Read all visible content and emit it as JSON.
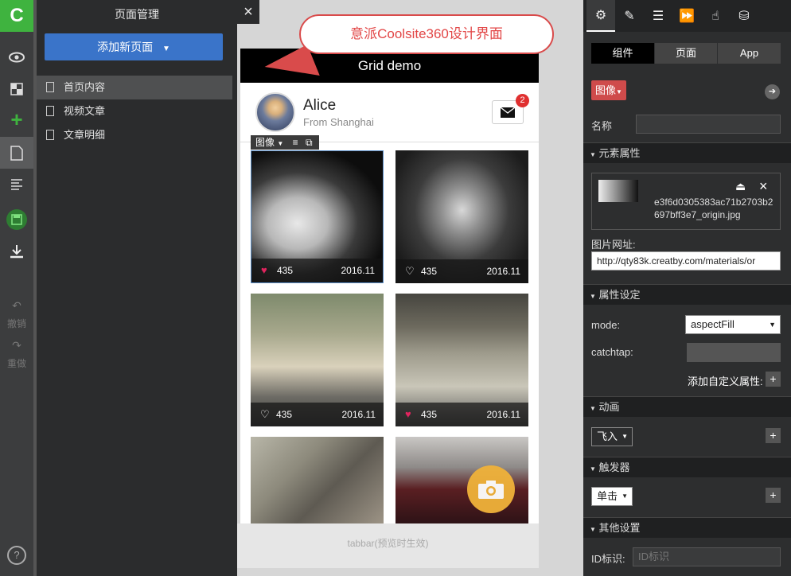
{
  "app": {
    "logo": "C"
  },
  "leftbar": {
    "undo": "撤销",
    "redo": "重做"
  },
  "pages_panel": {
    "title": "页面管理",
    "add_button": "添加新页面",
    "items": [
      {
        "label": "首页内容",
        "active": true
      },
      {
        "label": "视频文章",
        "active": false
      },
      {
        "label": "文章明细",
        "active": false
      }
    ]
  },
  "callout": {
    "text": "意派Coolsite360设计界面"
  },
  "phone": {
    "title": "Grid demo",
    "user": {
      "name": "Alice",
      "from": "From Shanghai"
    },
    "mail_badge": "2",
    "element_toolbar": {
      "label": "图像"
    },
    "cards": [
      {
        "likes": "435",
        "date": "2016.11",
        "liked": true
      },
      {
        "likes": "435",
        "date": "2016.11",
        "liked": false
      },
      {
        "likes": "435",
        "date": "2016.11",
        "liked": false
      },
      {
        "likes": "435",
        "date": "2016.11",
        "liked": true
      }
    ],
    "tabbar": "tabbar(预览时生效)"
  },
  "right_panel": {
    "segments": [
      "组件",
      "页面",
      "App"
    ],
    "component_type": "图像",
    "name_label": "名称",
    "name_value": "",
    "sections": {
      "element_props": "元素属性",
      "prop_settings": "属性设定",
      "animation": "动画",
      "trigger": "触发器",
      "other": "其他设置"
    },
    "image_file": "e3f6d0305383ac71b2703b2697bff3e7_origin.jpg",
    "image_url_label": "图片网址:",
    "image_url": "http://qty83k.creatby.com/materials/or",
    "mode_label": "mode:",
    "mode_value": "aspectFill",
    "catchtap_label": "catchtap:",
    "catchtap_value": "",
    "add_custom_attr": "添加自定义属性:",
    "animation_value": "飞入",
    "trigger_value": "单击",
    "id_label": "ID标识:",
    "id_placeholder": "ID标识"
  }
}
